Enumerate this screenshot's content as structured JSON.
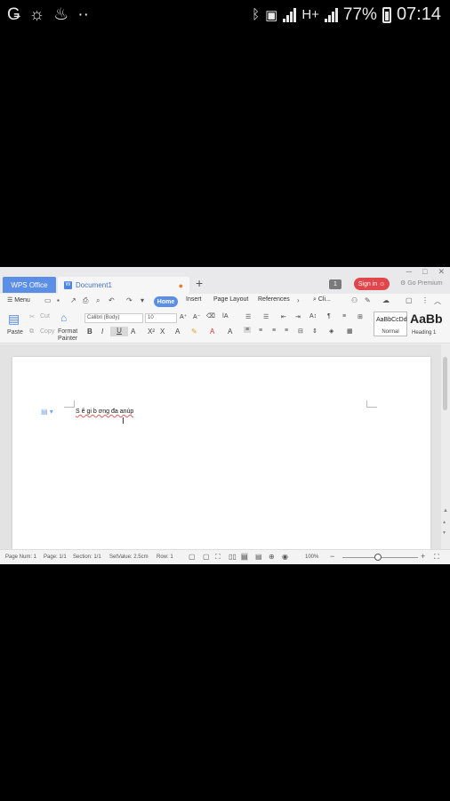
{
  "status_bar": {
    "battery": "77%",
    "time": "07:14",
    "network": "H+",
    "left_icons": [
      "g-icon",
      "weather-icon",
      "flame-icon",
      "dots-icon"
    ],
    "right_icons": [
      "bluetooth-icon",
      "nfc-icon",
      "signal-icon",
      "signal-icon",
      "battery-icon"
    ]
  },
  "tabs": {
    "app": "WPS Office",
    "document": "Document1",
    "add": "+"
  },
  "titlebar": {
    "count_badge": "1",
    "sign_in": "Sign in",
    "premium": "Go Premium"
  },
  "menu": {
    "menu_label": "Menu",
    "tabs": [
      "Home",
      "Insert",
      "Page Layout",
      "References"
    ],
    "search": "Cli..."
  },
  "ribbon": {
    "paste": "Paste",
    "cut": "Cut",
    "copy": "Copy",
    "format_painter_1": "Format",
    "format_painter_2": "Painter",
    "font_name": "Calibri (Body)",
    "font_size": "10",
    "styles": {
      "normal_sample": "AaBbCcDd",
      "normal_label": "Normal",
      "heading_sample": "AaBb",
      "heading_label": "Heading 1"
    }
  },
  "document": {
    "text": "S ẽ gi b ơng đa anúp"
  },
  "statusline": {
    "page_num": "Page Num: 1",
    "page": "Page: 1/1",
    "section": "Section: 1/1",
    "setvalue": "SetValue: 2.5cm",
    "row": "Row: 1",
    "zoom": "100%"
  },
  "colors": {
    "accent": "#5b8ee6",
    "sign_in": "#e0464b",
    "background": "#000000"
  }
}
